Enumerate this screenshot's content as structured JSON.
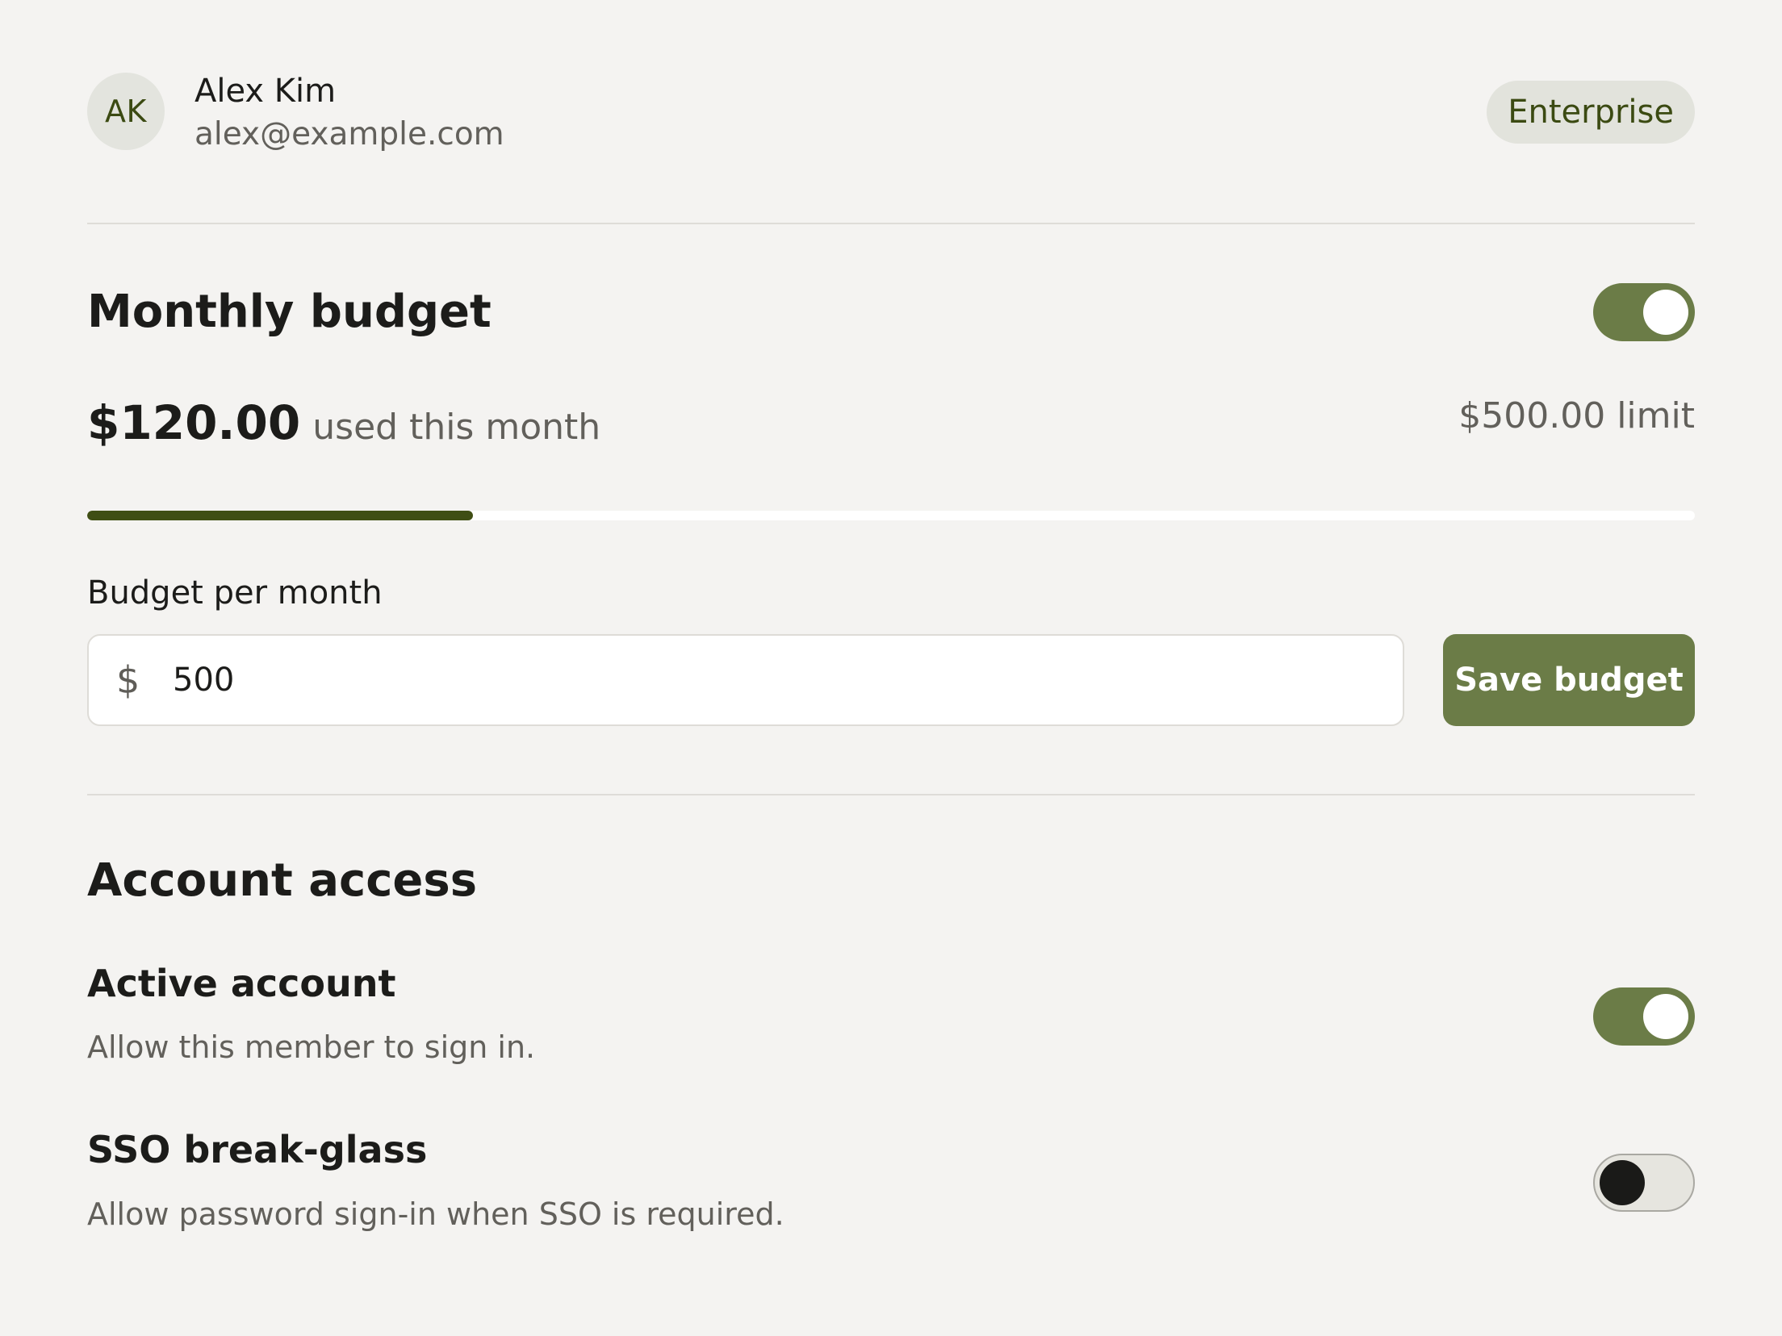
{
  "member": {
    "initials": "AK",
    "name": "Alex Kim",
    "email": "alex@example.com",
    "plan": "Enterprise"
  },
  "budget": {
    "title": "Monthly budget",
    "enabled": true,
    "used_amount": "$120.00",
    "used_label": "used this month",
    "limit_text": "$500.00 limit",
    "progress_fraction": 0.24,
    "field_label": "Budget per month",
    "currency_symbol": "$",
    "input_value": "500",
    "save_label": "Save budget"
  },
  "access": {
    "title": "Account access",
    "settings": [
      {
        "title": "Active account",
        "description": "Allow this member to sign in.",
        "enabled": true
      },
      {
        "title": "SSO break-glass",
        "description": "Allow password sign-in when SSO is required.",
        "enabled": false
      }
    ]
  },
  "colors": {
    "accent": "#6b7c47",
    "accent_dark": "#3f4e14",
    "background": "#f4f3f1"
  }
}
